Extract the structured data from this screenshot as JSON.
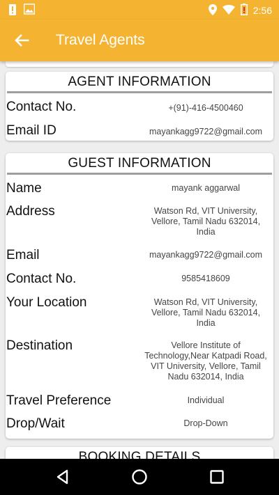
{
  "status_bar": {
    "time": "2:56"
  },
  "app_bar": {
    "title": "Travel Agents"
  },
  "agent_card": {
    "title": "AGENT INFORMATION",
    "rows": [
      {
        "label": "Contact No.",
        "value": "+(91)-416-4500460"
      },
      {
        "label": "Email ID",
        "value": "mayankagg9722@gmail.com"
      }
    ]
  },
  "guest_card": {
    "title": "GUEST INFORMATION",
    "rows": [
      {
        "label": "Name",
        "value": "mayank aggarwal"
      },
      {
        "label": "Address",
        "value_lines": [
          "Watson Rd, VIT University,",
          "Vellore, Tamil Nadu 632014,",
          "India"
        ]
      },
      {
        "label": "Email",
        "value": "mayankagg9722@gmail.com"
      },
      {
        "label": "Contact No.",
        "value": "9585418609"
      },
      {
        "label": "Your Location",
        "value_lines": [
          "Watson Rd, VIT University,",
          "Vellore, Tamil Nadu 632014,",
          "India"
        ]
      },
      {
        "label": "Destination",
        "value_lines": [
          "Vellore Institute of",
          "Technology,Near Katpadi Road,",
          "VIT University, Vellore, Tamil",
          "Nadu 632014, India"
        ]
      },
      {
        "label": "Travel Preference",
        "value": "Individual"
      },
      {
        "label": "Drop/Wait",
        "value": "Drop-Down"
      }
    ]
  },
  "booking_card": {
    "title": "BOOKING DETAILS"
  },
  "icons": {
    "status_left": [
      "notification-alert-icon",
      "image-icon"
    ],
    "status_right": [
      "location-icon",
      "wifi-icon",
      "battery-icon"
    ],
    "app_bar": "back-arrow-icon",
    "nav": [
      "back-triangle-icon",
      "home-circle-icon",
      "recents-square-icon"
    ]
  },
  "colors": {
    "accent": "#f4b431",
    "card": "#ffffff",
    "background": "#eeeeee"
  }
}
